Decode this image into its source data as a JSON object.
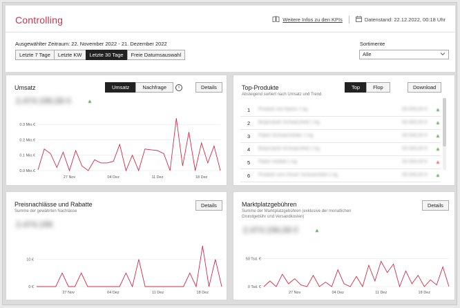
{
  "header": {
    "title": "Controlling",
    "kpi_link": "Weitere Infos zu den KPIs",
    "datenstand": "Datenstand: 22.12.2022, 00:18 Uhr"
  },
  "filter": {
    "range_label": "Ausgewählter Zeitraum: 22. November 2022 - 21. Dezember 2022",
    "buttons": [
      "Letzte 7 Tage",
      "Letzte KW",
      "Letzte 30 Tage",
      "Freie Datumsauswahl"
    ],
    "active_button": "Letzte 30 Tage",
    "sortiment_label": "Sortimente",
    "sortiment_value": "Alle"
  },
  "umsatz": {
    "title": "Umsatz",
    "toggle": [
      "Umsatz",
      "Nachfrage"
    ],
    "active_toggle": "Umsatz",
    "details": "Details",
    "blurred_value": "2.474.196,58 €"
  },
  "top_produkte": {
    "title": "Top-Produkte",
    "subtitle": "Absteigend sortiert nach Umsatz und Trend",
    "toggle": [
      "Top",
      "Flop"
    ],
    "active_toggle": "Top",
    "download": "Download",
    "rows": [
      {
        "rank": "1",
        "name": "Produkt mit Name 1 kg",
        "value": "00.000,00 €",
        "trend": "up"
      },
      {
        "rank": "2",
        "name": "Bioprodukt Schwarzfeld 1 kg",
        "value": "00.000,00 €",
        "trend": "up"
      },
      {
        "rank": "3",
        "name": "Paket Schwarzfelder 1 kg",
        "value": "00.000,00 €",
        "trend": "up"
      },
      {
        "rank": "4",
        "name": "Bioprodukt Schwarzfeld 1 kg",
        "value": "00.000,00 €",
        "trend": "up"
      },
      {
        "rank": "5",
        "name": "Paket Vielfalt 1 kg",
        "value": "00.000,00 €",
        "trend": "down"
      },
      {
        "rank": "6",
        "name": "Produkt vom Feuer Schwarzfeld 1 kg",
        "value": "00.000,00 €",
        "trend": "up"
      }
    ]
  },
  "preisnachlass": {
    "title": "Preisnachlässe und Rabatte",
    "subtitle": "Summe der gewährten Nachlässe",
    "details": "Details",
    "blurred_value": "2.474.196"
  },
  "marktplatz": {
    "title": "Marktplatzgebühren",
    "subtitle_1": "Summe der Marktplatzgebühren (exklusive der monatlichen",
    "subtitle_2": "Grundgebühr und Versandkosten)",
    "details": "Details",
    "blurred_value": "2.474.196,58 €"
  },
  "icons": {
    "kpi": "book-icon",
    "datenstand": "calendar-icon",
    "select": "chevron-down-icon",
    "info": "info-icon"
  },
  "colors": {
    "accent": "#d5304a",
    "line": "#d32a45",
    "trend_up": "#5aa84a",
    "trend_down": "#e0676f"
  },
  "chart_data": [
    {
      "id": "umsatz",
      "type": "line",
      "ylabels": [
        "0.3 Mio.€",
        "0.2 Mio.€",
        "0.1 Mio.€",
        "0.0 Mio.€"
      ],
      "yticks": [
        0.3,
        0.2,
        0.1,
        0.0
      ],
      "ylim": [
        0,
        0.35
      ],
      "xlabels": [
        "27 Nov",
        "04 Dez",
        "11 Dez",
        "18 Dez"
      ],
      "xlabel_index": [
        5,
        12,
        19,
        26
      ],
      "values": [
        0.005,
        0.14,
        0.11,
        0.02,
        0.12,
        0.0,
        0.13,
        0.03,
        0.0,
        0.07,
        0.05,
        0.05,
        0.06,
        0.17,
        0.0,
        0.1,
        0.0,
        0.14,
        0.135,
        0.13,
        0.11,
        0.0,
        0.34,
        0.03,
        0.25,
        0.0,
        0.18,
        0.05,
        0.16,
        0.0
      ],
      "grid": true
    },
    {
      "id": "preisnachlass",
      "type": "line",
      "ylabels": [
        "10 €",
        "0 €"
      ],
      "yticks": [
        10,
        0
      ],
      "ylim": [
        0,
        16
      ],
      "xlabels": [
        "27 Nov",
        "04 Dez",
        "11 Dez",
        "18 Dez"
      ],
      "xlabel_index": [
        5,
        12,
        19,
        26
      ],
      "values": [
        0,
        0,
        0,
        0,
        5,
        0,
        0,
        5,
        0,
        0,
        0,
        0,
        0,
        0,
        5,
        0,
        10,
        0,
        0,
        0,
        0,
        0,
        0,
        0,
        5,
        0,
        15,
        0,
        10,
        0
      ],
      "grid": true
    },
    {
      "id": "marktplatz",
      "type": "line",
      "ylabels": [
        "50 Tsd. €",
        "0 Tsd. €"
      ],
      "yticks": [
        50,
        0
      ],
      "ylim": [
        0,
        70
      ],
      "xlabels": [
        "27 Nov",
        "04 Dez",
        "11 Dez",
        "18 Dez"
      ],
      "xlabel_index": [
        5,
        12,
        19,
        26
      ],
      "values": [
        0,
        10,
        0,
        22,
        5,
        14,
        3,
        0,
        20,
        0,
        8,
        0,
        30,
        5,
        0,
        18,
        0,
        38,
        10,
        45,
        25,
        40,
        0,
        28,
        5,
        20,
        0,
        12,
        3,
        35,
        0
      ],
      "grid": true
    }
  ]
}
